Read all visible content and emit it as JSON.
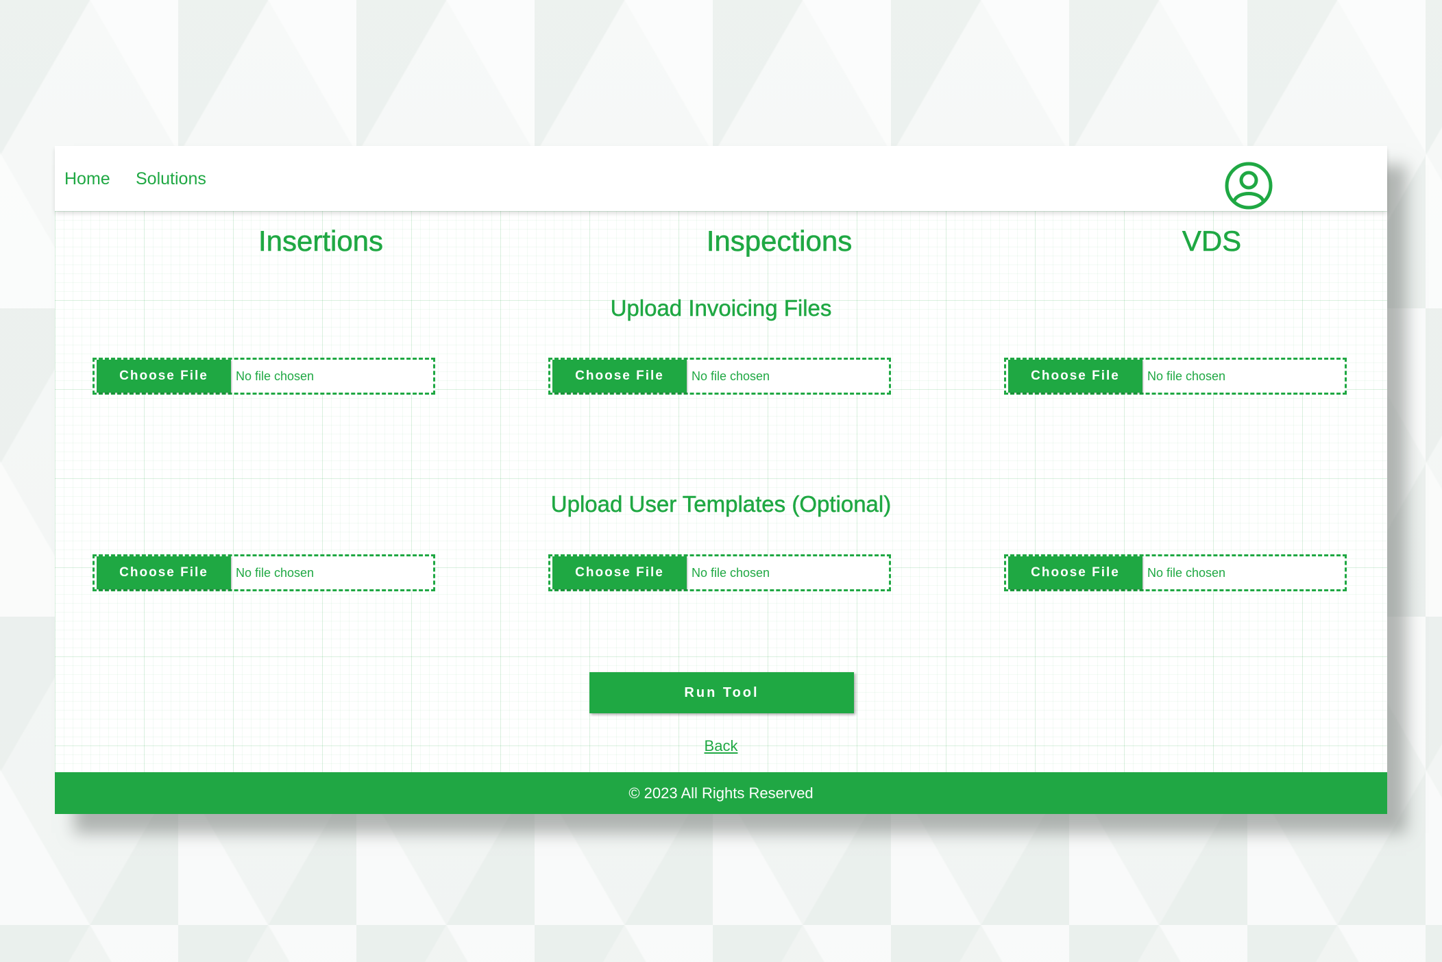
{
  "nav": {
    "home_label": "Home",
    "solutions_label": "Solutions",
    "profile_icon": "user-circle-icon"
  },
  "columns": [
    {
      "title": "Insertions"
    },
    {
      "title": "Inspections"
    },
    {
      "title": "VDS"
    }
  ],
  "sections": {
    "invoicing": {
      "title": "Upload Invoicing Files"
    },
    "templates": {
      "title": "Upload User Templates (Optional)"
    }
  },
  "file_input": {
    "button_label": "Choose File",
    "status": "No file chosen"
  },
  "actions": {
    "run_label": "Run Tool",
    "back_label": "Back"
  },
  "footer": {
    "text": "© 2023 All Rights Reserved"
  },
  "colors": {
    "accent": "#1fa843",
    "background": "#f3f5f4"
  }
}
